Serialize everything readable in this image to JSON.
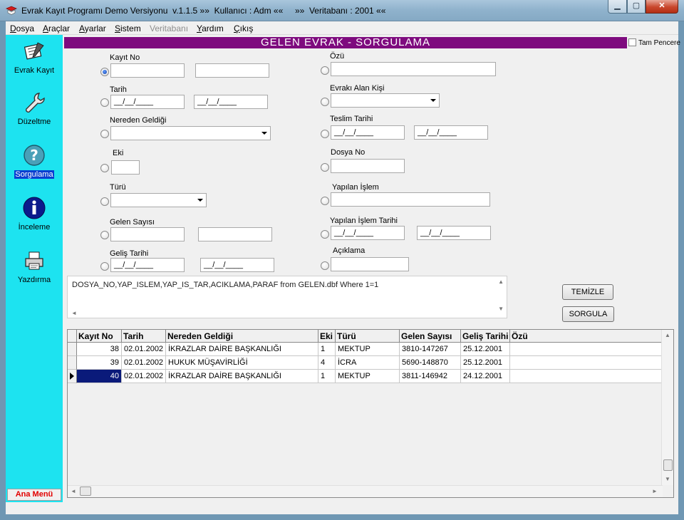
{
  "window": {
    "title": "Evrak Kayıt Programı Demo Versiyonu  v.1.1.5 »»  Kullanıcı : Adm ««     »»  Veritabanı : 2001 ««",
    "minimize": "▁",
    "maximize": "▢",
    "close": "✕"
  },
  "menu": [
    {
      "label": "Dosya",
      "key": "D",
      "rest": "osya",
      "disabled": false
    },
    {
      "label": "Araçlar",
      "key": "A",
      "rest": "raçlar",
      "disabled": false
    },
    {
      "label": "Ayarlar",
      "key": "A",
      "rest": "yarlar",
      "disabled": false
    },
    {
      "label": "Sistem",
      "key": "S",
      "rest": "istem",
      "disabled": false
    },
    {
      "label": "Veritabanı",
      "key": "V",
      "rest": "eritabanı",
      "disabled": true
    },
    {
      "label": "Yardım",
      "key": "Y",
      "rest": "ardım",
      "disabled": false
    },
    {
      "label": "Çıkış",
      "key": "Ç",
      "rest": "ıkış",
      "disabled": false
    }
  ],
  "sidebar": {
    "items": [
      {
        "label": "Evrak Kayıt",
        "icon": "document-pen-icon"
      },
      {
        "label": "Düzeltme",
        "icon": "wrench-icon"
      },
      {
        "label": "Sorgulama",
        "icon": "question-icon",
        "active": true
      },
      {
        "label": "İnceleme",
        "icon": "info-icon"
      },
      {
        "label": "Yazdırma",
        "icon": "printer-icon"
      }
    ],
    "ana_menu": "Ana Menü"
  },
  "form": {
    "header": "GELEN EVRAK - SORGULAMA",
    "tam_pencere": "Tam Pencere",
    "left_fields": {
      "kayit_no": "Kayıt No",
      "tarih": "Tarih",
      "nereden_geldigi": "Nereden Geldiği",
      "eki": "Eki",
      "turu": "Türü",
      "gelen_sayisi": "Gelen Sayısı",
      "gelis_tarihi": "Geliş Tarihi"
    },
    "right_fields": {
      "ozu": "Özü",
      "evraki_alan_kisi": "Evrakı Alan Kişi",
      "teslim_tarihi": "Teslim Tarihi",
      "dosya_no": "Dosya No",
      "yapilan_islem": "Yapılan İşlem",
      "yapilan_islem_tarihi": "Yapılan İşlem Tarihi",
      "aciklama": "Açıklama"
    },
    "date_mask": "__/__/____",
    "sql": "DOSYA_NO,YAP_ISLEM,YAP_IS_TAR,ACIKLAMA,PARAF from GELEN.dbf Where 1=1 ",
    "temizle": "TEMİZLE",
    "sorgula": "SORGULA"
  },
  "grid": {
    "columns": [
      "Kayıt No",
      "Tarih",
      "Nereden Geldiği",
      "Eki",
      "Türü",
      "Gelen Sayısı",
      "Geliş Tarihi",
      "Özü"
    ],
    "rows": [
      {
        "kayit_no": "38",
        "tarih": "02.01.2002",
        "nereden": "İKRAZLAR DAİRE BAŞKANLIĞI",
        "eki": "1",
        "turu": "MEKTUP",
        "gelen_sayisi": "3810-147267",
        "gelis_tarihi": "25.12.2001",
        "ozu": ""
      },
      {
        "kayit_no": "39",
        "tarih": "02.01.2002",
        "nereden": "HUKUK MÜŞAVİRLİĞİ",
        "eki": "4",
        "turu": "İCRA",
        "gelen_sayisi": "5690-148870",
        "gelis_tarihi": "25.12.2001",
        "ozu": ""
      },
      {
        "kayit_no": "40",
        "tarih": "02.01.2002",
        "nereden": "İKRAZLAR DAİRE BAŞKANLIĞI",
        "eki": "1",
        "turu": "MEKTUP",
        "gelen_sayisi": "3811-146942",
        "gelis_tarihi": "24.12.2001",
        "ozu": ""
      }
    ]
  },
  "colors": {
    "sidebar": "#1de3f0",
    "header": "#7e0b7e",
    "selection": "#0a1a7a",
    "ana_menu": "#e20000"
  }
}
